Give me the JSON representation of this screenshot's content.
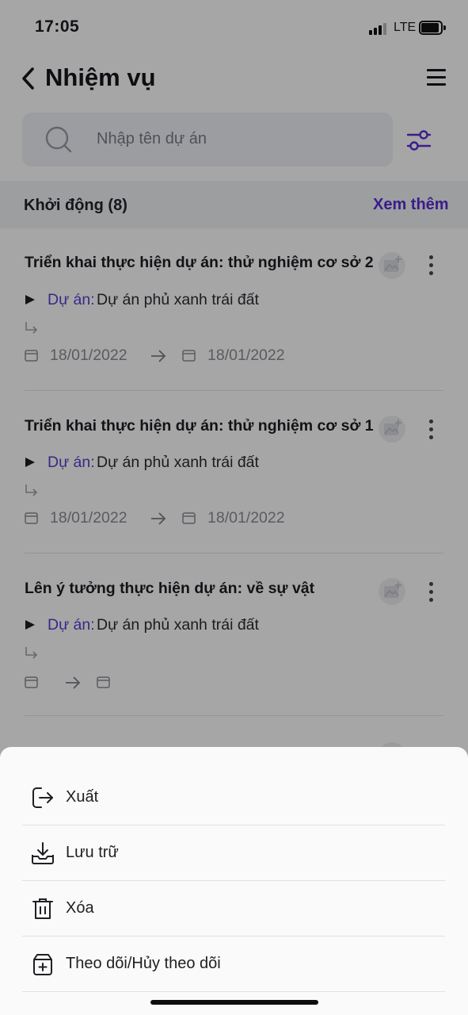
{
  "status_bar": {
    "time": "17:05",
    "network": "LTE"
  },
  "header": {
    "title": "Nhiệm vụ",
    "back_icon": "chevron-left-icon",
    "menu_icon": "hamburger-menu-icon"
  },
  "search": {
    "placeholder": "Nhập tên dự án",
    "value": "",
    "filter_icon": "sliders-icon"
  },
  "section": {
    "title": "Khởi động (8)",
    "see_more": "Xem thêm"
  },
  "tasks": [
    {
      "title": "Triển khai thực hiện dự án: thử nghiệm cơ sở 2",
      "project_label": "Dự án:",
      "project_name": "Dự án phủ xanh trái đất",
      "start_date": "18/01/2022",
      "end_date": "18/01/2022"
    },
    {
      "title": "Triển khai thực hiện dự án: thử nghiệm cơ sở 1",
      "project_label": "Dự án:",
      "project_name": "Dự án phủ xanh trái đất",
      "start_date": "18/01/2022",
      "end_date": "18/01/2022"
    },
    {
      "title": "Lên ý tưởng thực hiện dự án: về sự vật",
      "project_label": "Dự án:",
      "project_name": "Dự án phủ xanh trái đất",
      "start_date": "",
      "end_date": ""
    }
  ],
  "action_sheet": {
    "items": [
      {
        "label": "Xuất",
        "icon": "export-icon"
      },
      {
        "label": "Lưu trữ",
        "icon": "archive-download-icon"
      },
      {
        "label": "Xóa",
        "icon": "trash-icon"
      },
      {
        "label": "Theo dõi/Hủy theo dõi",
        "icon": "follow-box-icon"
      }
    ]
  },
  "colors": {
    "accent": "#5b2bd6",
    "project_label": "#5b3cd0",
    "date_text": "#8a8c96",
    "overlay": "rgba(0,0,0,0.35)"
  }
}
